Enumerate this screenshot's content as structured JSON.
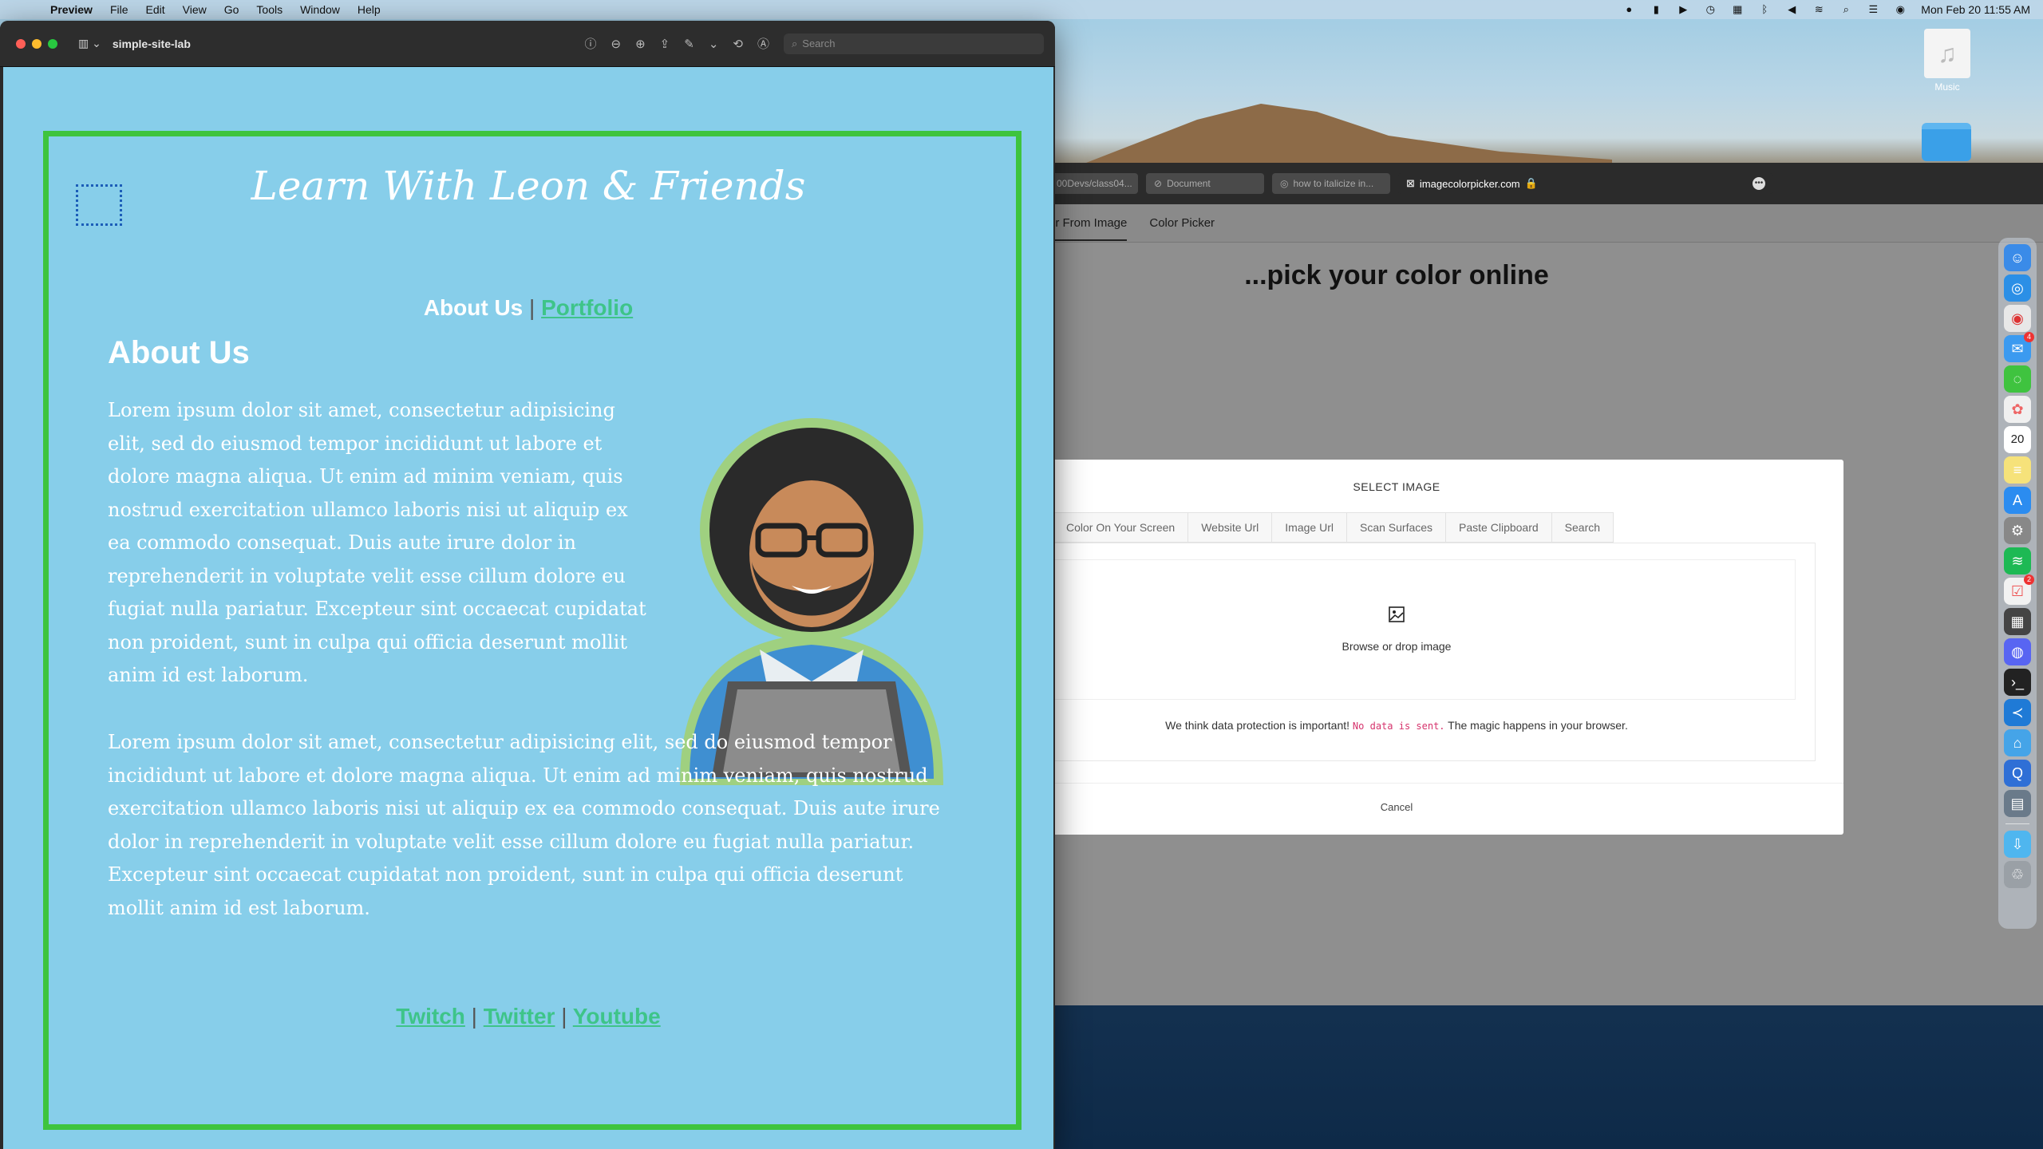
{
  "menubar": {
    "app": "Preview",
    "items": [
      "File",
      "Edit",
      "View",
      "Go",
      "Tools",
      "Window",
      "Help"
    ],
    "clock": "Mon Feb 20  11:55 AM"
  },
  "desktop": {
    "music_label": "Music"
  },
  "preview": {
    "title": "simple-site-lab",
    "search_placeholder": "Search"
  },
  "site": {
    "title": "Learn With Leon & Friends",
    "nav": {
      "about": "About Us",
      "sep": "|",
      "portfolio": "Portfolio"
    },
    "heading": "About Us",
    "paragraph1": "Lorem ipsum dolor sit amet, consectetur adipisicing elit, sed do eiusmod tempor incididunt ut labore et dolore magna aliqua. Ut enim ad minim veniam, quis nostrud exercitation ullamco laboris nisi ut aliquip ex ea commodo consequat. Duis aute irure dolor in reprehenderit in voluptate velit esse cillum dolore eu fugiat nulla pariatur. Excepteur sint occaecat cupidatat non proident, sunt in culpa qui officia deserunt mollit anim id est laborum.",
    "paragraph2": "Lorem ipsum dolor sit amet, consectetur adipisicing elit, sed do eiusmod tempor incididunt ut labore et dolore magna aliqua. Ut enim ad minim veniam, quis nostrud exercitation ullamco laboris nisi ut aliquip ex ea commodo consequat. Duis aute irure dolor in reprehenderit in voluptate velit esse cillum dolore eu fugiat nulla pariatur. Excepteur sint occaecat cupidatat non proident, sunt in culpa qui officia deserunt mollit anim id est laborum.",
    "footer": {
      "twitch": "Twitch",
      "twitter": "Twitter",
      "youtube": "Youtube",
      "sep": "|"
    }
  },
  "browser": {
    "tabs": [
      "00Devs/class04...",
      "Document",
      "how to italicize in...",
      "imagecolorpicker.com"
    ],
    "nav": {
      "from_image": "or From Image",
      "picker": "Color Picker"
    },
    "headline": "...pick your color online",
    "modal": {
      "title": "SELECT IMAGE",
      "tabs": [
        "ge",
        "Color On Your Screen",
        "Website Url",
        "Image Url",
        "Scan Surfaces",
        "Paste Clipboard",
        "Search"
      ],
      "drop_text": "Browse or drop image",
      "privacy_before": "We think data protection is important! ",
      "privacy_code": "No data is sent.",
      "privacy_after": " The magic happens in your browser.",
      "cancel": "Cancel"
    }
  },
  "dock": {
    "calendar_day": "20"
  },
  "colors": {
    "page_bg": "#87ceea",
    "frame": "#3ec43e",
    "link": "#3ec489"
  }
}
